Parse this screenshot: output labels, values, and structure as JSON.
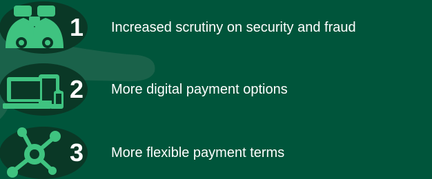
{
  "colors": {
    "background": "#00553b",
    "badge_dark": "#0a3826",
    "icon_green": "#3fc380",
    "text": "#ffffff"
  },
  "items": [
    {
      "number": "1",
      "icon": "binoculars-icon",
      "label": "Increased scrutiny on security and fraud"
    },
    {
      "number": "2",
      "icon": "devices-icon",
      "label": "More digital payment options"
    },
    {
      "number": "3",
      "icon": "network-hub-icon",
      "label": "More flexible payment terms"
    }
  ]
}
